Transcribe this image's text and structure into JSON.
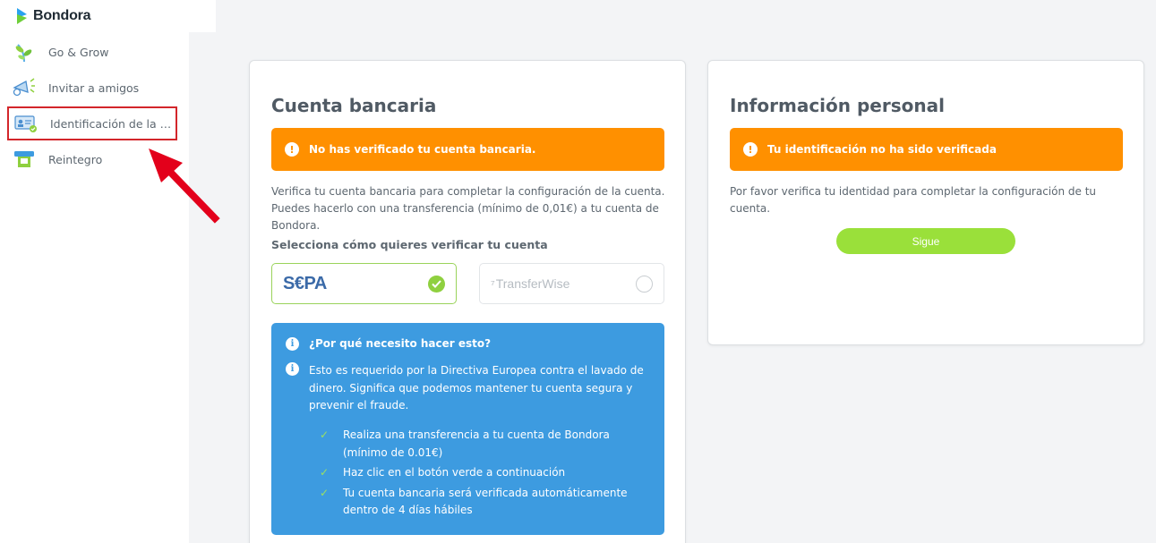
{
  "app": {
    "brand": "Bondora"
  },
  "sidebar": {
    "items": [
      {
        "label": "Go & Grow",
        "icon": "plant-icon"
      },
      {
        "label": "Invitar a amigos",
        "icon": "megaphone-icon"
      },
      {
        "label": "Identificación de la Cu...",
        "icon": "id-card-icon",
        "active": true
      },
      {
        "label": "Reintegro",
        "icon": "atm-icon"
      }
    ]
  },
  "bank_card": {
    "title": "Cuenta bancaria",
    "alert": "No has verificado tu cuenta bancaria.",
    "description": "Verifica tu cuenta bancaria para completar la configuración de la cuenta. Puedes hacerlo con una transferencia (mínimo de 0,01€) a tu cuenta de Bondora.",
    "select_label": "Selecciona cómo quieres verificar tu cuenta",
    "methods": [
      {
        "label": "S€PA",
        "selected": true
      },
      {
        "label": "TransferWise",
        "selected": false
      }
    ],
    "info": {
      "question": "¿Por qué necesito hacer esto?",
      "explanation": "Esto es requerido por la Directiva Europea contra el lavado de dinero. Significa que podemos mantener tu cuenta segura y prevenir el fraude.",
      "steps": [
        "Realiza una transferencia a tu cuenta de Bondora (mínimo de 0.01€)",
        "Haz clic en el botón verde a continuación",
        "Tu cuenta bancaria será verificada automáticamente dentro de 4 días hábiles"
      ]
    }
  },
  "personal_card": {
    "title": "Información personal",
    "alert": "Tu identificación no ha sido verificada",
    "description": "Por favor verifica tu identidad para completar la configuración de tu cuenta.",
    "button": "Sigue"
  },
  "colors": {
    "alert": "#ff9000",
    "info": "#3d9be0",
    "accent_green": "#9ae03a",
    "highlight": "#d3262b"
  }
}
